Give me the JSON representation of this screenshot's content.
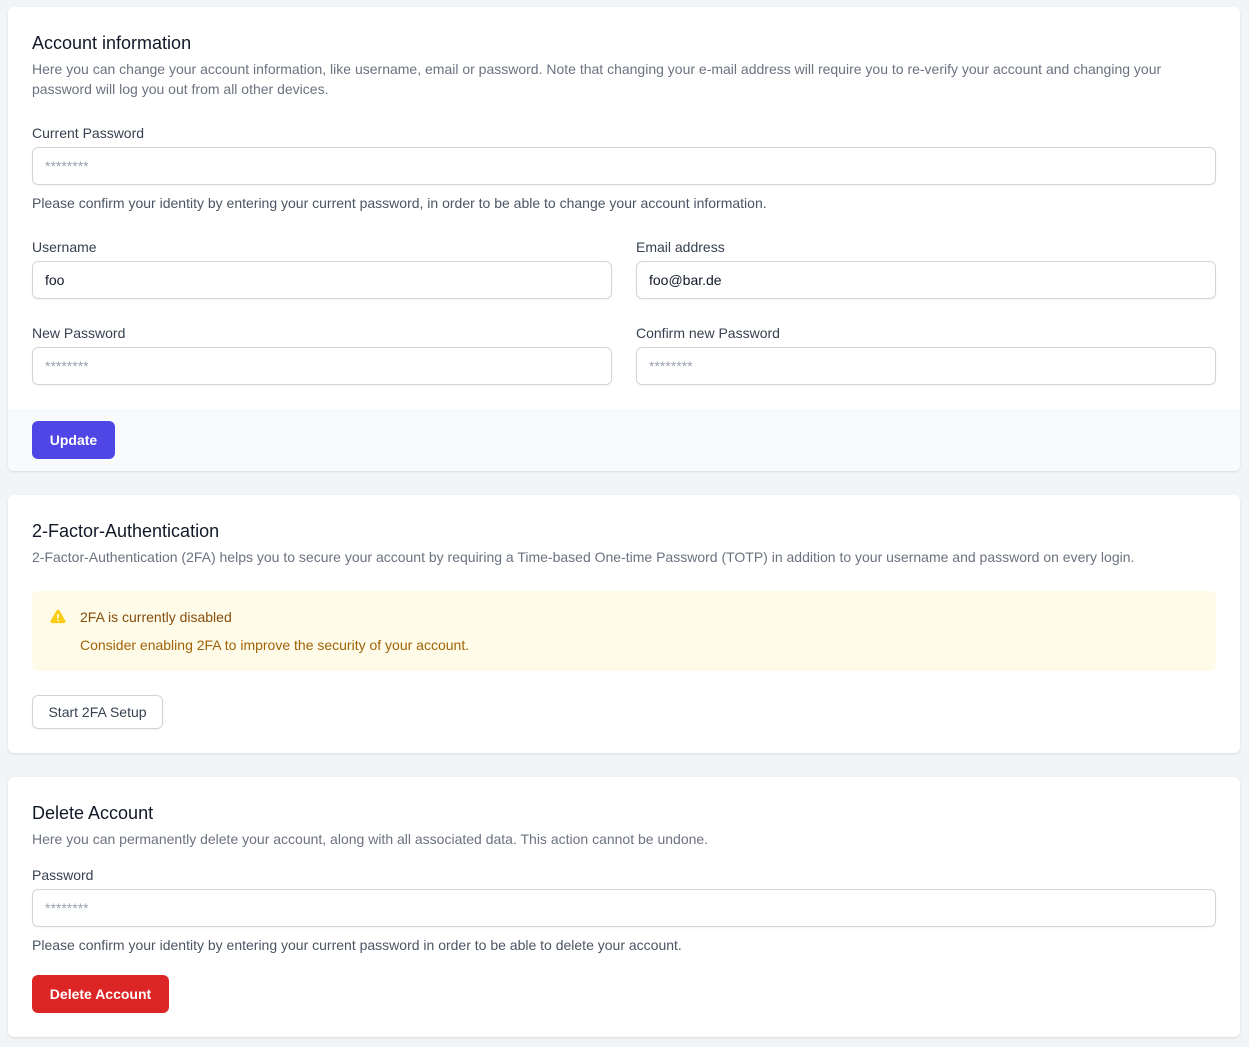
{
  "account": {
    "title": "Account information",
    "description": "Here you can change your account information, like username, email or password. Note that changing your e-mail address will require you to re-verify your account and changing your password will log you out from all other devices.",
    "current_password_label": "Current Password",
    "current_password_placeholder": "********",
    "current_password_help": "Please confirm your identity by entering your current password, in order to be able to change your account information.",
    "username_label": "Username",
    "username_value": "foo",
    "email_label": "Email address",
    "email_value": "foo@bar.de",
    "new_password_label": "New Password",
    "new_password_placeholder": "********",
    "confirm_password_label": "Confirm new Password",
    "confirm_password_placeholder": "********",
    "update_button": "Update"
  },
  "twofa": {
    "title": "2-Factor-Authentication",
    "description": "2-Factor-Authentication (2FA) helps you to secure your account by requiring a Time-based One-time Password (TOTP) in addition to your username and password on every login.",
    "alert_icon": "warning-icon",
    "alert_title": "2FA is currently disabled",
    "alert_text": "Consider enabling 2FA to improve the security of your account.",
    "setup_button": "Start 2FA Setup"
  },
  "delete": {
    "title": "Delete Account",
    "description": "Here you can permanently delete your account, along with all associated data. This action cannot be undone.",
    "password_label": "Password",
    "password_placeholder": "********",
    "password_help": "Please confirm your identity by entering your current password in order to be able to delete your account.",
    "delete_button": "Delete Account"
  },
  "colors": {
    "primary": "#4f46e5",
    "danger": "#dc2626",
    "warning_bg": "#fefce8",
    "warning_icon": "#facc15"
  }
}
